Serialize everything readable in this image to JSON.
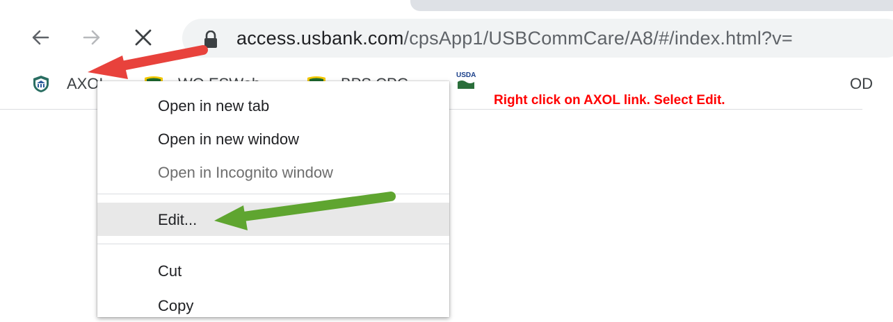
{
  "browser": {
    "url_host": "access.usbank.com",
    "url_path": "/cpsApp1/USBCommCare/A8/#/index.html?v="
  },
  "icons": {
    "back": "back-arrow-icon",
    "forward": "forward-arrow-icon",
    "close": "close-icon",
    "lock": "lock-icon"
  },
  "bookmarks": [
    {
      "label": "AXOL",
      "icon": "axol-icon"
    },
    {
      "label": "WO ESWeb",
      "icon": "shield-icon"
    },
    {
      "label": "BPS CPG",
      "icon": "shield-icon"
    },
    {
      "label": "USDA",
      "icon": "usda-logo"
    },
    {
      "label": "OD",
      "icon": ""
    }
  ],
  "annotation": {
    "text": "Right click on AXOL link.  Select Edit.",
    "color": "#ff0000"
  },
  "context_menu": {
    "items": [
      {
        "label": "Open in new tab",
        "enabled": true
      },
      {
        "label": "Open in new window",
        "enabled": true
      },
      {
        "label": "Open in Incognito window",
        "enabled": false
      },
      {
        "label": "Edit...",
        "enabled": true,
        "highlighted": true
      },
      {
        "label": "Cut",
        "enabled": true
      },
      {
        "label": "Copy",
        "enabled": true
      }
    ]
  },
  "arrows": [
    {
      "name": "red-arrow",
      "color": "#e8423c",
      "points_to": "AXOL bookmark"
    },
    {
      "name": "green-arrow",
      "color": "#5fa530",
      "points_to": "Edit..."
    }
  ]
}
